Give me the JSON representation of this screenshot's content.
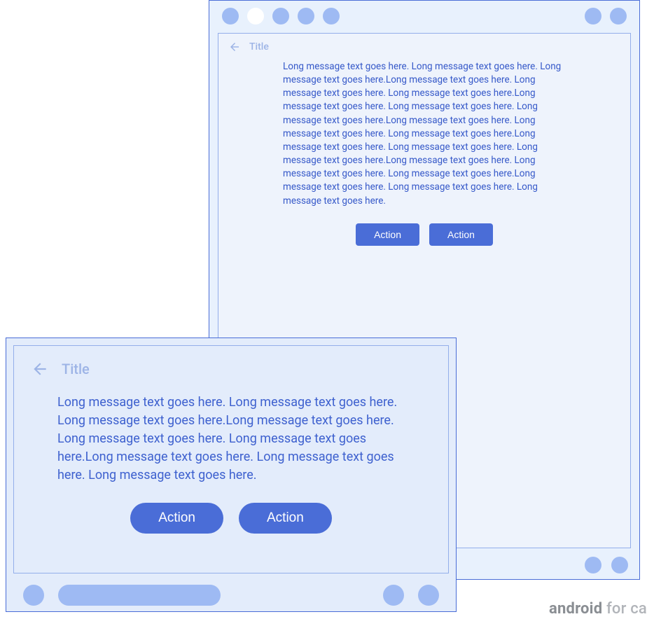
{
  "colors": {
    "accent": "#4a6dd7",
    "text": "#3659c9",
    "muted": "#9db4e6",
    "panel": "#e8f1fd",
    "dot": "#9ebaf3"
  },
  "frame_a": {
    "title": "Title",
    "message": "Long message text goes here. Long message text goes here. Long message text goes here.Long message text goes here. Long message text goes here. Long message text goes here.Long message text goes here. Long message text goes here. Long message text goes here.Long message text goes here. Long message text goes here. Long message text goes here.Long message text goes here. Long message text goes here. Long message text goes here.Long message text goes here. Long message text goes here. Long message text goes here.Long message text goes here. Long message text goes here. Long message text goes here.",
    "actions": [
      "Action",
      "Action"
    ]
  },
  "frame_b": {
    "title": "Title",
    "message": "Long message text goes here. Long message text goes here. Long message text goes here.Long message text goes here. Long message text goes here. Long message text goes here.Long message text goes here. Long message text goes here. Long message text goes here.",
    "actions": [
      "Action",
      "Action"
    ]
  },
  "watermark": {
    "bold": "android",
    "rest": " for ca"
  }
}
